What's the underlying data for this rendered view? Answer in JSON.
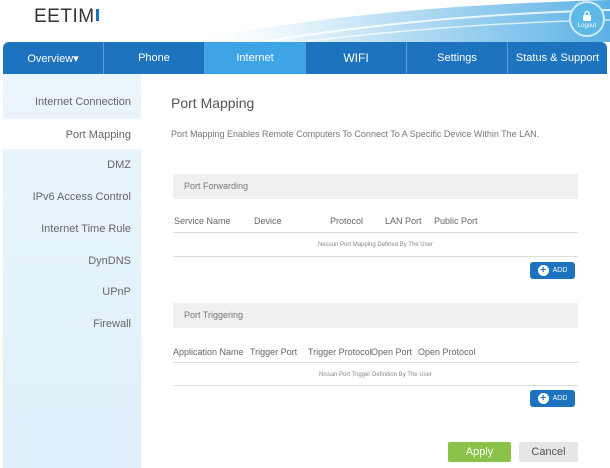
{
  "header": {
    "logo_text": "EETIM",
    "logout_label": "Logout"
  },
  "nav": {
    "tabs": [
      {
        "label": "Overview▾"
      },
      {
        "label": "Phone"
      },
      {
        "label": "Internet"
      },
      {
        "label": "WIFI"
      },
      {
        "label": "Settings"
      },
      {
        "label": "Status & Support"
      }
    ]
  },
  "sidebar": {
    "items": [
      {
        "label": "Internet Connection"
      },
      {
        "label": "Port Mapping"
      },
      {
        "label": "DMZ"
      },
      {
        "label": "IPv6 Access Control"
      },
      {
        "label": "Internet Time Rule"
      },
      {
        "label": "DynDNS"
      },
      {
        "label": "UPnP"
      },
      {
        "label": "Firewall"
      }
    ]
  },
  "main": {
    "title": "Port Mapping",
    "description": "Port Mapping Enables Remote Computers To Connect To A Specific Device Within The LAN.",
    "forwarding": {
      "heading": "Port Forwarding",
      "columns": [
        "Service Name",
        "Device",
        "Protocol",
        "LAN Port",
        "Public Port"
      ],
      "empty_text": "Nessun Port Mapping Defined By The User",
      "add_label": "ADD"
    },
    "triggering": {
      "heading": "Port Triggering",
      "columns": [
        "Application Name",
        "Trigger Port",
        "Trigger Protocol",
        "Open Port",
        "Open Protocol"
      ],
      "empty_text": "Nissan Port Trigger Definition By The User",
      "add_label": "ADD"
    },
    "apply_label": "Apply",
    "cancel_label": "Cancel"
  },
  "colors": {
    "nav_blue": "#1e73be",
    "nav_active": "#3da4e6",
    "apply_green": "#8bc34a"
  },
  "icons": [
    "lock-icon",
    "plus-icon"
  ]
}
